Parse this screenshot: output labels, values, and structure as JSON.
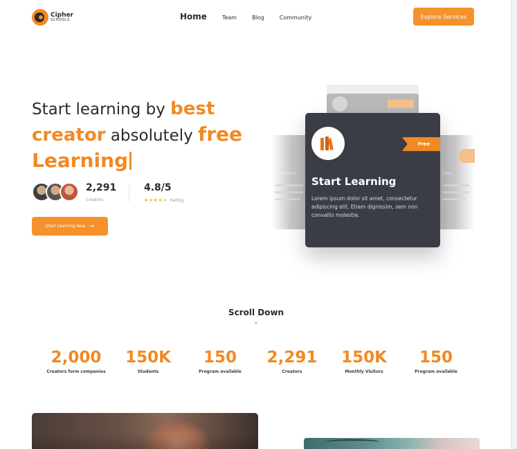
{
  "header": {
    "logo_line1": "Cipher",
    "logo_line2": "SCHOOLS",
    "nav": [
      "Home",
      "Team",
      "Blog",
      "Community"
    ],
    "cta": "Explore Services"
  },
  "hero": {
    "title_part1": "Start learning by ",
    "title_accent1": "best",
    "title_accent2": "creator",
    "title_part2": " absolutely ",
    "title_accent3": "free",
    "title_accent4": "Learning",
    "creators_value": "2,291",
    "creators_label": "Creators",
    "rating_value": "4.8/5",
    "rating_label": "Rating",
    "rating_stars": 4,
    "button_label": "Start Learning Now",
    "button_icon": "arrow-right-icon"
  },
  "cards": {
    "tag": "Free",
    "title": "Start Learning",
    "body": "Lorem ipsum dolor sit amet, consectetur adipiscing elit. Etiam dignissim, sem non convallis molestie.",
    "ghost_left_title": "n Certificat",
    "ghost_right_title": "tion"
  },
  "scroll": {
    "label": "Scroll Down",
    "icon": "chevron-down-icon"
  },
  "stats": [
    {
      "value": "2,000",
      "label": "Creators form companies"
    },
    {
      "value": "150K",
      "label": "Students"
    },
    {
      "value": "150",
      "label": "Program available"
    },
    {
      "value": "2,291",
      "label": "Creators"
    },
    {
      "value": "150K",
      "label": "Monthly Visitors"
    },
    {
      "value": "150",
      "label": "Program available"
    }
  ],
  "colors": {
    "accent": "#f08a24",
    "card_dark": "#3b3d46",
    "text": "#2b2b2b"
  }
}
